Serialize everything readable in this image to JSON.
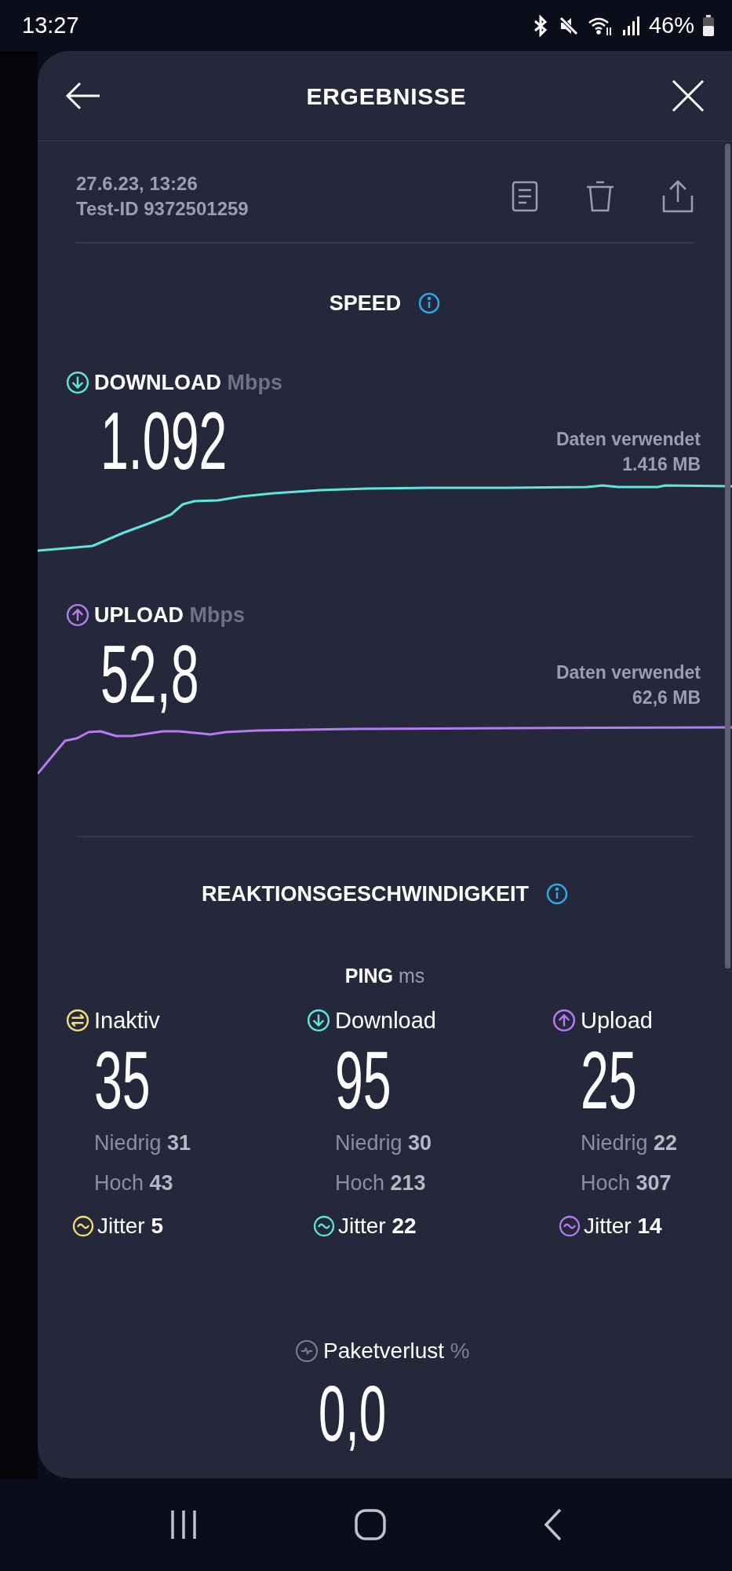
{
  "status_bar": {
    "time": "13:27",
    "battery": "46%"
  },
  "header": {
    "title": "ERGEBNISSE"
  },
  "test": {
    "date": "27.6.23, 13:26",
    "test_id": "Test-ID 9372501259"
  },
  "speed": {
    "title": "SPEED",
    "results": [
      {
        "kind": "download",
        "label": "DOWNLOAD",
        "unit": "Mbps",
        "value": "1.092",
        "data_label": "Daten verwendet",
        "data_value": "1.416 MB",
        "color": "#5ee6dc"
      },
      {
        "kind": "upload",
        "label": "UPLOAD",
        "unit": "Mbps",
        "value": "52,8",
        "data_label": "Daten verwendet",
        "data_value": "62,6 MB",
        "color": "#b57cf2"
      }
    ]
  },
  "latency": {
    "title": "REAKTIONSGESCHWINDIGKEIT",
    "ping_label": "PING",
    "ping_unit": "ms",
    "columns": [
      {
        "kind": "idle",
        "label": "Inaktiv",
        "value": "35",
        "low_label": "Niedrig",
        "low": "31",
        "high_label": "Hoch",
        "high": "43",
        "jitter_label": "Jitter",
        "jitter": "5",
        "color": "#f2df78"
      },
      {
        "kind": "download",
        "label": "Download",
        "value": "95",
        "low_label": "Niedrig",
        "low": "30",
        "high_label": "Hoch",
        "high": "213",
        "jitter_label": "Jitter",
        "jitter": "22",
        "color": "#5ee6dc"
      },
      {
        "kind": "upload",
        "label": "Upload",
        "value": "25",
        "low_label": "Niedrig",
        "low": "22",
        "high_label": "Hoch",
        "high": "307",
        "jitter_label": "Jitter",
        "jitter": "14",
        "color": "#b57cf2"
      }
    ]
  },
  "packet_loss": {
    "label": "Paketverlust",
    "unit": "%",
    "value": "0,0"
  }
}
